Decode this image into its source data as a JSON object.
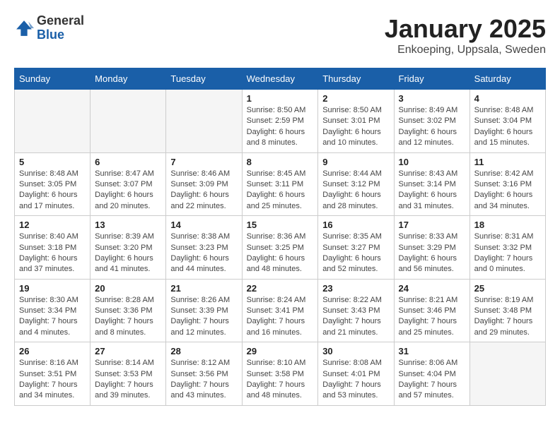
{
  "header": {
    "logo_general": "General",
    "logo_blue": "Blue",
    "month_title": "January 2025",
    "location": "Enkoeping, Uppsala, Sweden"
  },
  "days_of_week": [
    "Sunday",
    "Monday",
    "Tuesday",
    "Wednesday",
    "Thursday",
    "Friday",
    "Saturday"
  ],
  "weeks": [
    [
      {
        "day": "",
        "empty": true
      },
      {
        "day": "",
        "empty": true
      },
      {
        "day": "",
        "empty": true
      },
      {
        "day": "1",
        "sunrise": "8:50 AM",
        "sunset": "2:59 PM",
        "daylight": "6 hours and 8 minutes."
      },
      {
        "day": "2",
        "sunrise": "8:50 AM",
        "sunset": "3:01 PM",
        "daylight": "6 hours and 10 minutes."
      },
      {
        "day": "3",
        "sunrise": "8:49 AM",
        "sunset": "3:02 PM",
        "daylight": "6 hours and 12 minutes."
      },
      {
        "day": "4",
        "sunrise": "8:48 AM",
        "sunset": "3:04 PM",
        "daylight": "6 hours and 15 minutes."
      }
    ],
    [
      {
        "day": "5",
        "sunrise": "8:48 AM",
        "sunset": "3:05 PM",
        "daylight": "6 hours and 17 minutes."
      },
      {
        "day": "6",
        "sunrise": "8:47 AM",
        "sunset": "3:07 PM",
        "daylight": "6 hours and 20 minutes."
      },
      {
        "day": "7",
        "sunrise": "8:46 AM",
        "sunset": "3:09 PM",
        "daylight": "6 hours and 22 minutes."
      },
      {
        "day": "8",
        "sunrise": "8:45 AM",
        "sunset": "3:11 PM",
        "daylight": "6 hours and 25 minutes."
      },
      {
        "day": "9",
        "sunrise": "8:44 AM",
        "sunset": "3:12 PM",
        "daylight": "6 hours and 28 minutes."
      },
      {
        "day": "10",
        "sunrise": "8:43 AM",
        "sunset": "3:14 PM",
        "daylight": "6 hours and 31 minutes."
      },
      {
        "day": "11",
        "sunrise": "8:42 AM",
        "sunset": "3:16 PM",
        "daylight": "6 hours and 34 minutes."
      }
    ],
    [
      {
        "day": "12",
        "sunrise": "8:40 AM",
        "sunset": "3:18 PM",
        "daylight": "6 hours and 37 minutes."
      },
      {
        "day": "13",
        "sunrise": "8:39 AM",
        "sunset": "3:20 PM",
        "daylight": "6 hours and 41 minutes."
      },
      {
        "day": "14",
        "sunrise": "8:38 AM",
        "sunset": "3:23 PM",
        "daylight": "6 hours and 44 minutes."
      },
      {
        "day": "15",
        "sunrise": "8:36 AM",
        "sunset": "3:25 PM",
        "daylight": "6 hours and 48 minutes."
      },
      {
        "day": "16",
        "sunrise": "8:35 AM",
        "sunset": "3:27 PM",
        "daylight": "6 hours and 52 minutes."
      },
      {
        "day": "17",
        "sunrise": "8:33 AM",
        "sunset": "3:29 PM",
        "daylight": "6 hours and 56 minutes."
      },
      {
        "day": "18",
        "sunrise": "8:31 AM",
        "sunset": "3:32 PM",
        "daylight": "7 hours and 0 minutes."
      }
    ],
    [
      {
        "day": "19",
        "sunrise": "8:30 AM",
        "sunset": "3:34 PM",
        "daylight": "7 hours and 4 minutes."
      },
      {
        "day": "20",
        "sunrise": "8:28 AM",
        "sunset": "3:36 PM",
        "daylight": "7 hours and 8 minutes."
      },
      {
        "day": "21",
        "sunrise": "8:26 AM",
        "sunset": "3:39 PM",
        "daylight": "7 hours and 12 minutes."
      },
      {
        "day": "22",
        "sunrise": "8:24 AM",
        "sunset": "3:41 PM",
        "daylight": "7 hours and 16 minutes."
      },
      {
        "day": "23",
        "sunrise": "8:22 AM",
        "sunset": "3:43 PM",
        "daylight": "7 hours and 21 minutes."
      },
      {
        "day": "24",
        "sunrise": "8:21 AM",
        "sunset": "3:46 PM",
        "daylight": "7 hours and 25 minutes."
      },
      {
        "day": "25",
        "sunrise": "8:19 AM",
        "sunset": "3:48 PM",
        "daylight": "7 hours and 29 minutes."
      }
    ],
    [
      {
        "day": "26",
        "sunrise": "8:16 AM",
        "sunset": "3:51 PM",
        "daylight": "7 hours and 34 minutes."
      },
      {
        "day": "27",
        "sunrise": "8:14 AM",
        "sunset": "3:53 PM",
        "daylight": "7 hours and 39 minutes."
      },
      {
        "day": "28",
        "sunrise": "8:12 AM",
        "sunset": "3:56 PM",
        "daylight": "7 hours and 43 minutes."
      },
      {
        "day": "29",
        "sunrise": "8:10 AM",
        "sunset": "3:58 PM",
        "daylight": "7 hours and 48 minutes."
      },
      {
        "day": "30",
        "sunrise": "8:08 AM",
        "sunset": "4:01 PM",
        "daylight": "7 hours and 53 minutes."
      },
      {
        "day": "31",
        "sunrise": "8:06 AM",
        "sunset": "4:04 PM",
        "daylight": "7 hours and 57 minutes."
      },
      {
        "day": "",
        "empty": true
      }
    ]
  ]
}
